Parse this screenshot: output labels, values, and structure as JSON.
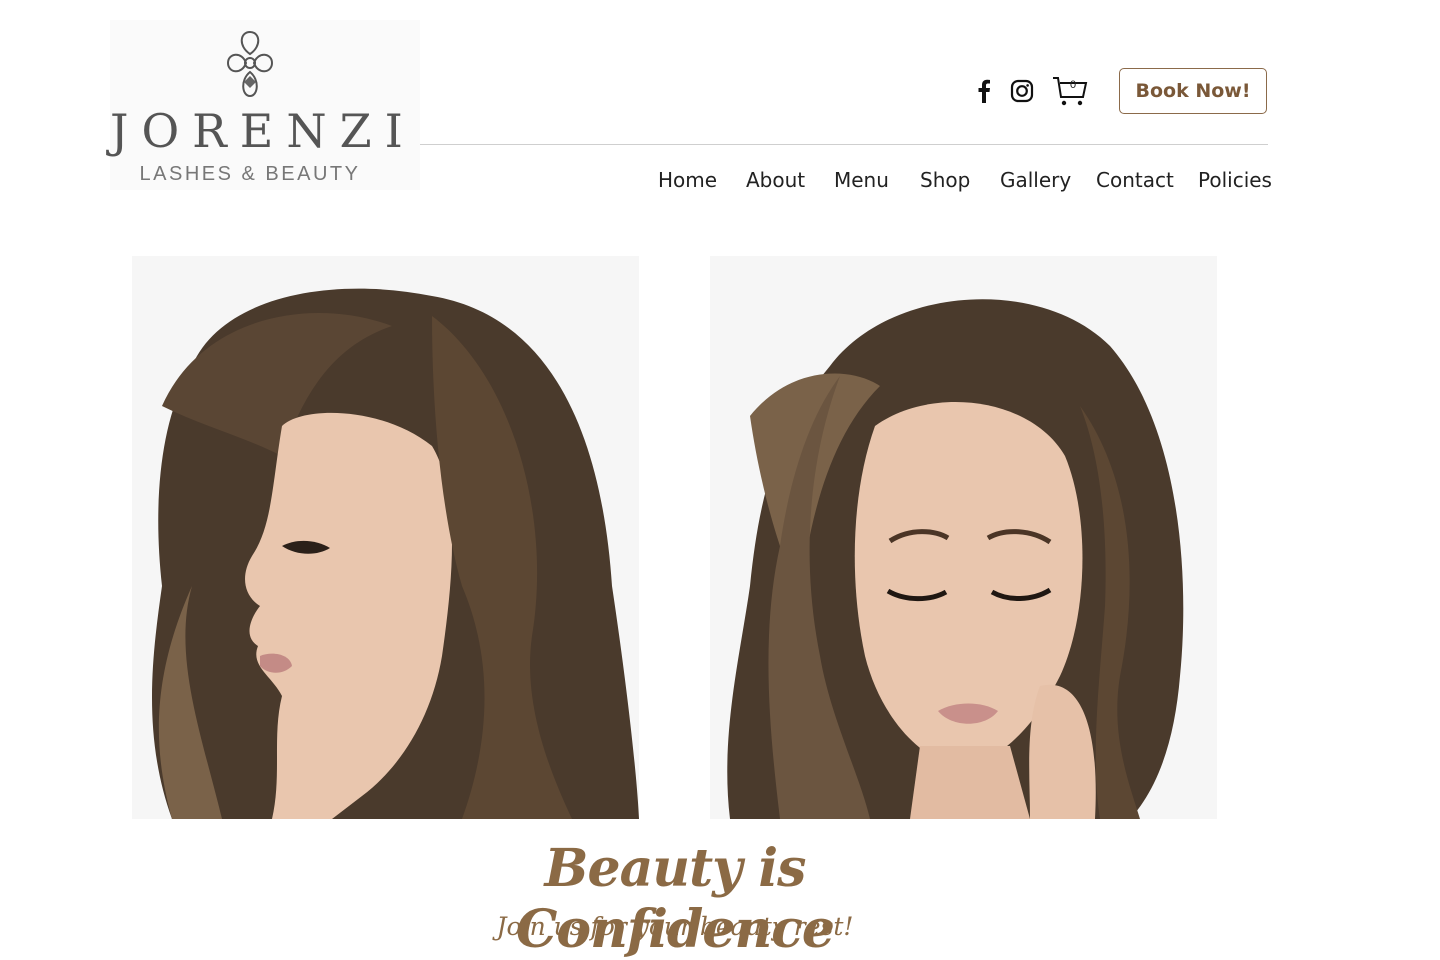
{
  "brand": {
    "name": "JORENZI",
    "tagline": "LASHES & BEAUTY"
  },
  "header": {
    "social": [
      "facebook-icon",
      "instagram-icon"
    ],
    "cart_count": "0",
    "book_label": "Book Now!"
  },
  "nav": {
    "items": [
      "Home",
      "About",
      "Menu",
      "Shop",
      "Gallery",
      "Contact",
      "Policies"
    ]
  },
  "hero": {
    "headline": "Beauty is Confidence",
    "subline": "Join us for your beauty rest!"
  },
  "colors": {
    "accent": "#8b6a45",
    "hair": "#4a3a2c",
    "skin": "#e9c6ae"
  }
}
